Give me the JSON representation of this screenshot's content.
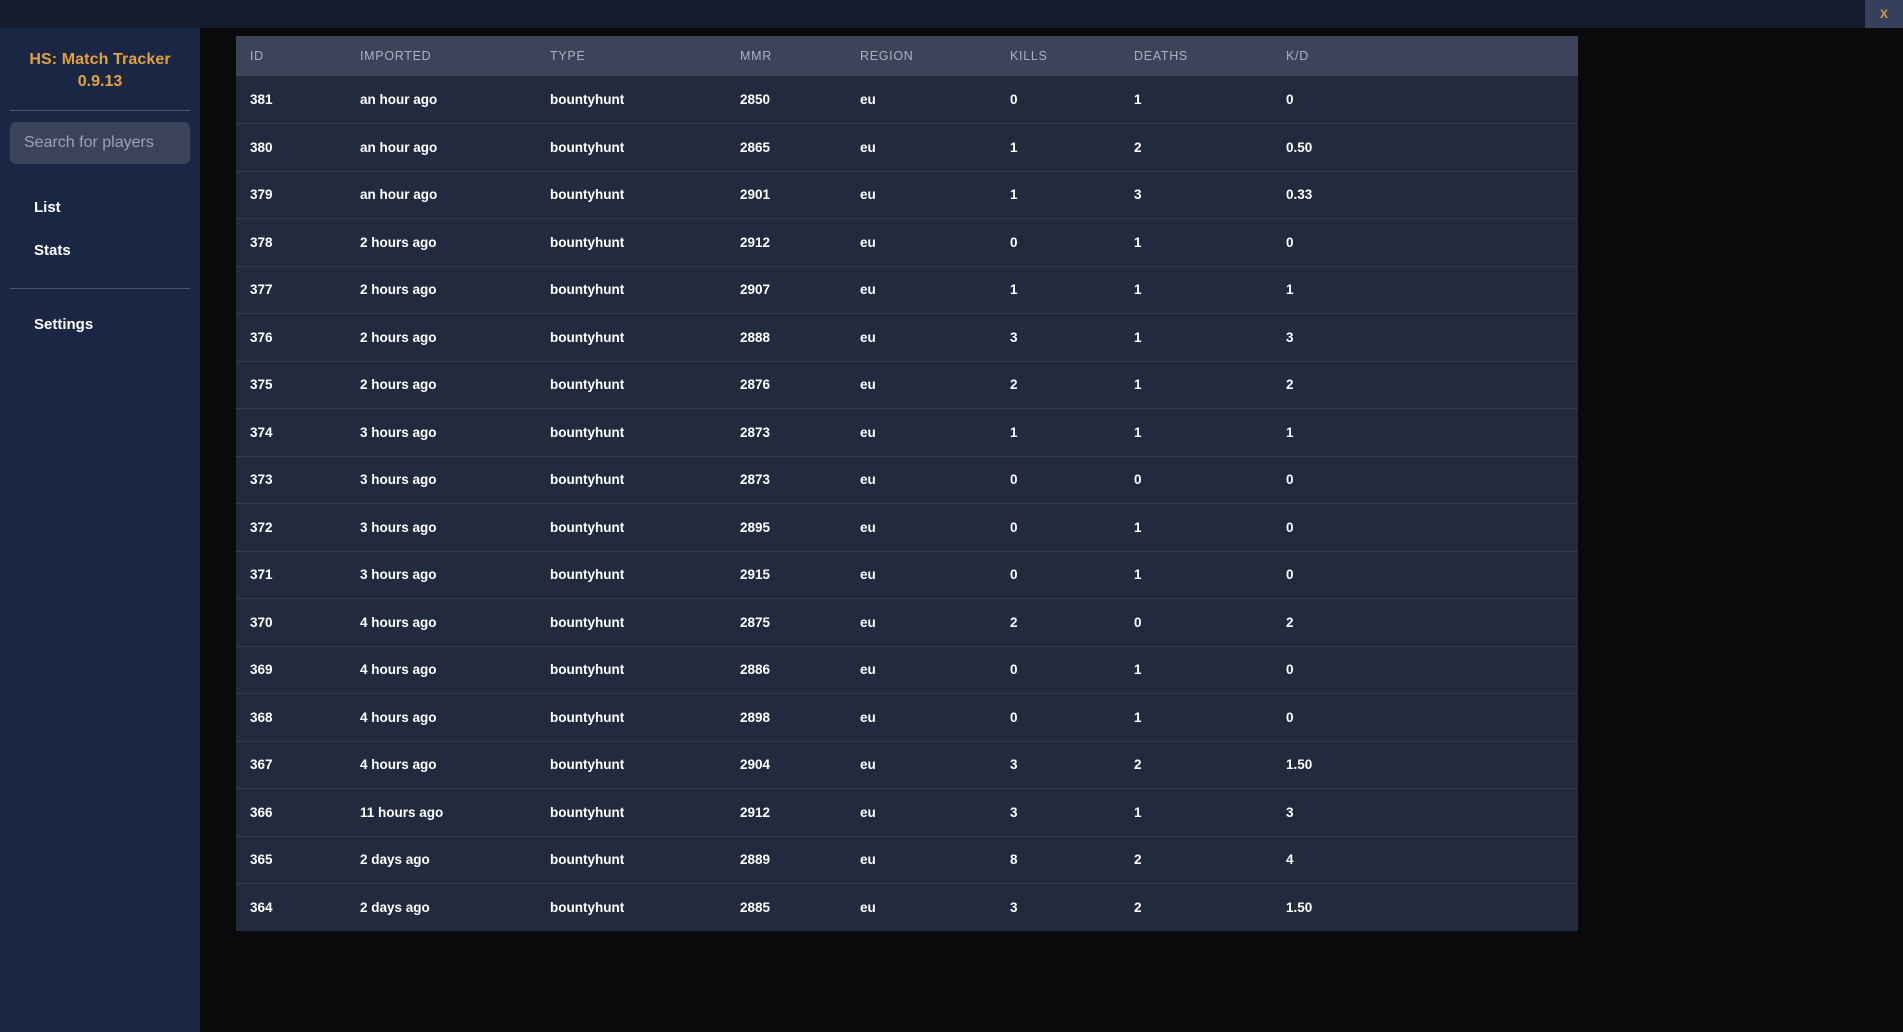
{
  "window": {
    "close_label": "X"
  },
  "sidebar": {
    "brand_title": "HS: Match Tracker",
    "brand_version": "0.9.13",
    "search": {
      "placeholder": "Search for players",
      "value": ""
    },
    "nav_primary": [
      {
        "label": "List",
        "name": "sidebar-item-list"
      },
      {
        "label": "Stats",
        "name": "sidebar-item-stats"
      }
    ],
    "nav_secondary": [
      {
        "label": "Settings",
        "name": "sidebar-item-settings"
      }
    ]
  },
  "table": {
    "columns": [
      {
        "key": "id",
        "label": "ID"
      },
      {
        "key": "imported",
        "label": "IMPORTED"
      },
      {
        "key": "type",
        "label": "TYPE"
      },
      {
        "key": "mmr",
        "label": "MMR"
      },
      {
        "key": "region",
        "label": "REGION"
      },
      {
        "key": "kills",
        "label": "KILLS"
      },
      {
        "key": "deaths",
        "label": "DEATHS"
      },
      {
        "key": "kd",
        "label": "K/D"
      }
    ],
    "rows": [
      {
        "id": "381",
        "imported": "an hour ago",
        "type": "bountyhunt",
        "mmr": "2850",
        "region": "eu",
        "kills": "0",
        "deaths": "1",
        "kd": "0"
      },
      {
        "id": "380",
        "imported": "an hour ago",
        "type": "bountyhunt",
        "mmr": "2865",
        "region": "eu",
        "kills": "1",
        "deaths": "2",
        "kd": "0.50"
      },
      {
        "id": "379",
        "imported": "an hour ago",
        "type": "bountyhunt",
        "mmr": "2901",
        "region": "eu",
        "kills": "1",
        "deaths": "3",
        "kd": "0.33"
      },
      {
        "id": "378",
        "imported": "2 hours ago",
        "type": "bountyhunt",
        "mmr": "2912",
        "region": "eu",
        "kills": "0",
        "deaths": "1",
        "kd": "0"
      },
      {
        "id": "377",
        "imported": "2 hours ago",
        "type": "bountyhunt",
        "mmr": "2907",
        "region": "eu",
        "kills": "1",
        "deaths": "1",
        "kd": "1"
      },
      {
        "id": "376",
        "imported": "2 hours ago",
        "type": "bountyhunt",
        "mmr": "2888",
        "region": "eu",
        "kills": "3",
        "deaths": "1",
        "kd": "3"
      },
      {
        "id": "375",
        "imported": "2 hours ago",
        "type": "bountyhunt",
        "mmr": "2876",
        "region": "eu",
        "kills": "2",
        "deaths": "1",
        "kd": "2"
      },
      {
        "id": "374",
        "imported": "3 hours ago",
        "type": "bountyhunt",
        "mmr": "2873",
        "region": "eu",
        "kills": "1",
        "deaths": "1",
        "kd": "1"
      },
      {
        "id": "373",
        "imported": "3 hours ago",
        "type": "bountyhunt",
        "mmr": "2873",
        "region": "eu",
        "kills": "0",
        "deaths": "0",
        "kd": "0"
      },
      {
        "id": "372",
        "imported": "3 hours ago",
        "type": "bountyhunt",
        "mmr": "2895",
        "region": "eu",
        "kills": "0",
        "deaths": "1",
        "kd": "0"
      },
      {
        "id": "371",
        "imported": "3 hours ago",
        "type": "bountyhunt",
        "mmr": "2915",
        "region": "eu",
        "kills": "0",
        "deaths": "1",
        "kd": "0"
      },
      {
        "id": "370",
        "imported": "4 hours ago",
        "type": "bountyhunt",
        "mmr": "2875",
        "region": "eu",
        "kills": "2",
        "deaths": "0",
        "kd": "2"
      },
      {
        "id": "369",
        "imported": "4 hours ago",
        "type": "bountyhunt",
        "mmr": "2886",
        "region": "eu",
        "kills": "0",
        "deaths": "1",
        "kd": "0"
      },
      {
        "id": "368",
        "imported": "4 hours ago",
        "type": "bountyhunt",
        "mmr": "2898",
        "region": "eu",
        "kills": "0",
        "deaths": "1",
        "kd": "0"
      },
      {
        "id": "367",
        "imported": "4 hours ago",
        "type": "bountyhunt",
        "mmr": "2904",
        "region": "eu",
        "kills": "3",
        "deaths": "2",
        "kd": "1.50"
      },
      {
        "id": "366",
        "imported": "11 hours ago",
        "type": "bountyhunt",
        "mmr": "2912",
        "region": "eu",
        "kills": "3",
        "deaths": "1",
        "kd": "3"
      },
      {
        "id": "365",
        "imported": "2 days ago",
        "type": "bountyhunt",
        "mmr": "2889",
        "region": "eu",
        "kills": "8",
        "deaths": "2",
        "kd": "4"
      },
      {
        "id": "364",
        "imported": "2 days ago",
        "type": "bountyhunt",
        "mmr": "2885",
        "region": "eu",
        "kills": "3",
        "deaths": "2",
        "kd": "1.50"
      }
    ]
  },
  "colors": {
    "brand_accent": "#e2a13f",
    "sidebar_bg": "#1a2744",
    "table_header_bg": "#3b4459",
    "table_row_bg": "#222b3d",
    "page_bg": "#0a0a0c",
    "titlebar_bg": "#141c2e"
  }
}
